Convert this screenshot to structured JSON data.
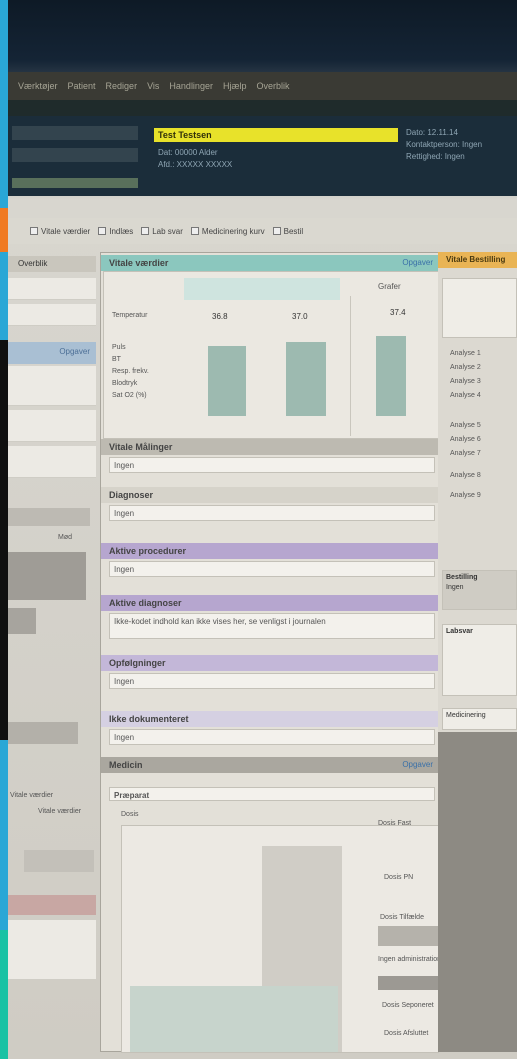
{
  "menu": {
    "items": [
      "Værktøjer",
      "Patient",
      "Rediger",
      "Vis",
      "Handlinger",
      "Hjælp",
      "Overblik"
    ]
  },
  "patient": {
    "name": "Test Testsen",
    "line1": "Dat: 00000  Alder",
    "line2": "Afd.: XXXXX  XXXXX",
    "right1": "Dato: 12.11.14",
    "right2": "Kontaktperson: Ingen",
    "right3": "Rettighed: Ingen"
  },
  "toolbar": {
    "items": [
      "Vitale værdier",
      "Indlæs",
      "Lab svar",
      "Medicinering kurv",
      "Bestil"
    ]
  },
  "left": {
    "head": "Overblik",
    "link": "Opgaver",
    "label_a": "Mød",
    "label_b": "Vitale værdier",
    "label_c": "Vitale værdier"
  },
  "vitals": {
    "title": "Vitale værdier",
    "link": "Opgaver",
    "header_right": "Grafer",
    "rows": [
      "Temperatur",
      "Puls",
      "BT",
      "Resp. frekv.",
      "Blodtryk",
      "Sat O2 (%)"
    ],
    "values": [
      "36.8",
      "37.0",
      "37.4"
    ]
  },
  "sections": [
    {
      "title": "Vitale Målinger",
      "body": "Ingen"
    },
    {
      "title": "Diagnoser",
      "body": "Ingen"
    },
    {
      "title": "Aktive procedurer",
      "body": "Ingen"
    },
    {
      "title": "Aktive diagnoser",
      "body": "Ikke-kodet indhold kan ikke vises her, se venligst i journalen"
    },
    {
      "title": "Opfølgninger",
      "body": "Ingen"
    },
    {
      "title": "Ikke dokumenteret",
      "body": "Ingen"
    }
  ],
  "medicin": {
    "title": "Medicin",
    "link": "Opgaver",
    "col1": "Præparat",
    "col2": "Dosis",
    "labels": [
      "Dosis Fast",
      "Dosis PN",
      "Dosis Tilfælde",
      "Ingen administration",
      "Dosis Seponeret",
      "Dosis Afsluttet"
    ]
  },
  "right": {
    "head": "Vitale Bestilling",
    "items": [
      "Analyse 1",
      "Analyse 2",
      "Analyse 3",
      "Analyse 4",
      "Analyse 5",
      "Analyse 6",
      "Analyse 7",
      "Analyse 8",
      "Analyse 9"
    ],
    "sub_head": "Bestilling",
    "sub_body": "Ingen",
    "block_head": "Labsvar",
    "block2_head": "Medicinering"
  }
}
